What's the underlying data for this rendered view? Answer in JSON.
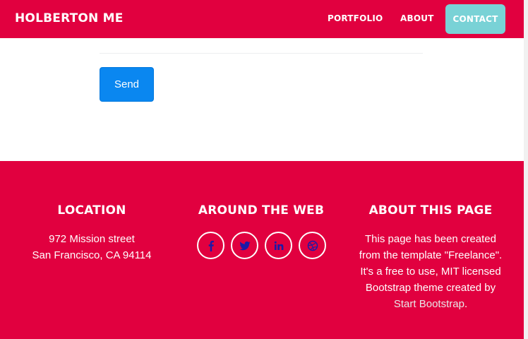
{
  "navbar": {
    "brand": "HOLBERTON ME",
    "links": {
      "portfolio": "PORTFOLIO",
      "about": "ABOUT",
      "contact": "CONTACT"
    }
  },
  "form": {
    "send_label": "Send"
  },
  "footer": {
    "location": {
      "heading": "LOCATION",
      "line1": "972 Mission street",
      "line2": "San Francisco, CA 94114"
    },
    "web": {
      "heading": "AROUND THE WEB",
      "icons": [
        "facebook-icon",
        "twitter-icon",
        "linkedin-icon",
        "dribbble-icon"
      ]
    },
    "about": {
      "heading": "ABOUT THIS PAGE",
      "text": "This page has been created from the template \"Freelance\". It's a free to use, MIT licensed Bootstrap theme created by",
      "link_text": "Start Bootstrap",
      "suffix": "."
    }
  },
  "colors": {
    "primary": "#e1003f",
    "contact_button": "#79d2d6",
    "send_button": "#0a87f0",
    "icon_color": "#1a1aa8"
  }
}
